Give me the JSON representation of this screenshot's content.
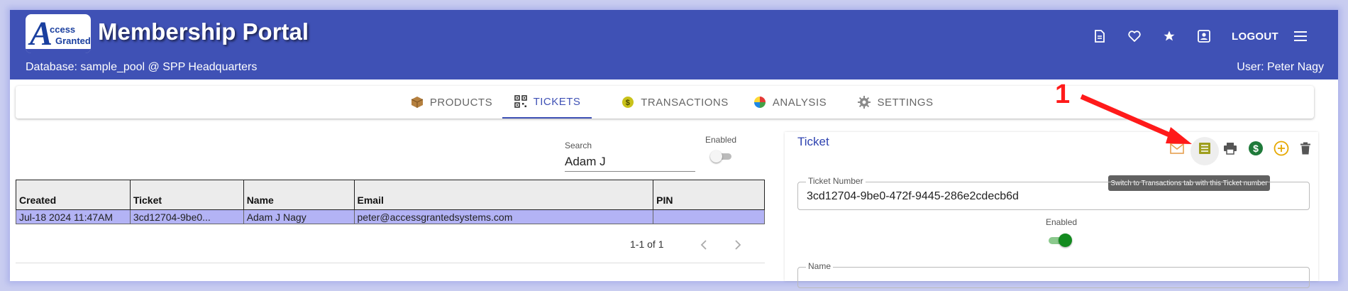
{
  "header": {
    "logo": {
      "text_main": "A",
      "text_line1": "ccess",
      "text_line2": "Granted"
    },
    "title": "Membership Portal",
    "database_line": "Database: sample_pool @ SPP Headquarters",
    "user_line": "User: Peter Nagy",
    "icons": [
      "document-icon",
      "heart-icon",
      "star-icon",
      "account-box-icon"
    ],
    "logout_label": "LOGOUT",
    "menu_icon": "hamburger-menu-icon",
    "background_color": "#3f51b5"
  },
  "tabs": [
    {
      "label": "PRODUCTS",
      "icon": "package-icon",
      "active": false
    },
    {
      "label": "TICKETS",
      "icon": "qr-code-icon",
      "active": true
    },
    {
      "label": "TRANSACTIONS",
      "icon": "coin-icon",
      "active": false
    },
    {
      "label": "ANALYSIS",
      "icon": "color-wheel-icon",
      "active": false
    },
    {
      "label": "SETTINGS",
      "icon": "gear-icon",
      "active": false
    }
  ],
  "search": {
    "label": "Search",
    "value": "Adam J"
  },
  "enabled_filter": {
    "label": "Enabled",
    "on": false
  },
  "table": {
    "columns": [
      "Created",
      "Ticket",
      "Name",
      "Email",
      "PIN"
    ],
    "rows": [
      {
        "created": "Jul-18 2024 11:47AM",
        "ticket": "3cd12704-9be0...",
        "name": "Adam J Nagy",
        "email": "peter@accessgrantedsystems.com",
        "pin": ""
      }
    ],
    "selected_row_color": "#b3b3f5"
  },
  "pagination": {
    "text": "1-1 of 1"
  },
  "ticket_panel": {
    "title": "Ticket",
    "actions": [
      {
        "icon": "email-icon",
        "color": "#e6a050"
      },
      {
        "icon": "transactions-list-icon",
        "color": "#9e9e1e"
      },
      {
        "icon": "printer-icon",
        "color": "#555555"
      },
      {
        "icon": "dollar-circle-icon",
        "color": "#1f7a3a"
      },
      {
        "icon": "add-circle-icon",
        "color": "#e6a800"
      },
      {
        "icon": "trash-icon",
        "color": "#555555"
      }
    ],
    "tooltip": "Switch to Transactions tab with this Ticket number",
    "ticket_number_label": "Ticket Number",
    "ticket_number_value": "3cd12704-9be0-472f-9445-286e2cdecb6d",
    "enabled_label": "Enabled",
    "enabled_on": true,
    "name_label": "Name"
  },
  "annotation": {
    "number": "1",
    "color": "#ff1a1a"
  }
}
